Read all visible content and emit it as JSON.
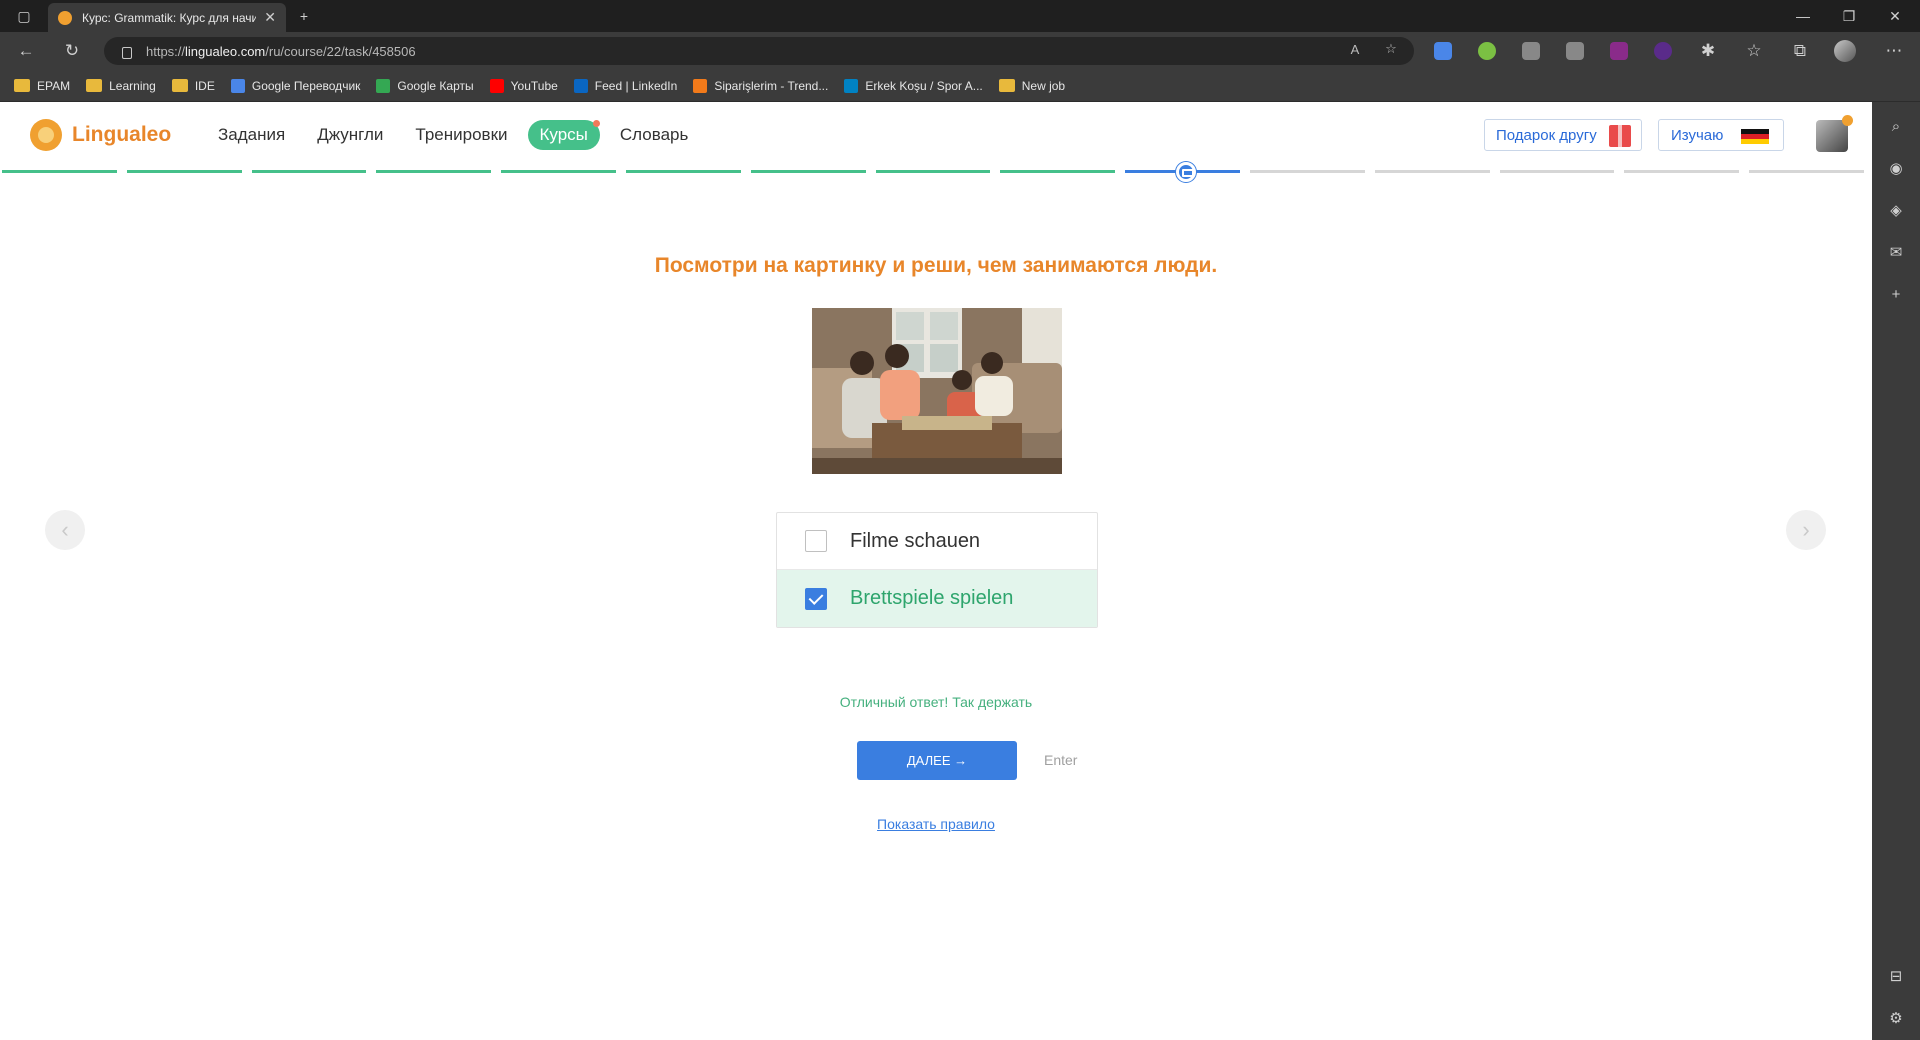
{
  "browser": {
    "tab_title": "Курс: Grammatik: Курс для начи",
    "url_prefix": "https://",
    "url_host": "lingualeo.com",
    "url_path": "/ru/course/22/task/458506",
    "bookmarks": [
      {
        "label": "EPAM",
        "icon": "folder-icon",
        "color": "#e8b93c"
      },
      {
        "label": "Learning",
        "icon": "folder-icon",
        "color": "#e8b93c"
      },
      {
        "label": "IDE",
        "icon": "folder-icon",
        "color": "#e8b93c"
      },
      {
        "label": "Google Переводчик",
        "icon": "google-translate-icon",
        "color": "#4a86e8"
      },
      {
        "label": "Google Карты",
        "icon": "google-maps-icon",
        "color": "#34a853"
      },
      {
        "label": "YouTube",
        "icon": "youtube-icon",
        "color": "#ff0000"
      },
      {
        "label": "Feed | LinkedIn",
        "icon": "linkedin-icon",
        "color": "#0a66c2"
      },
      {
        "label": "Siparişlerim - Trend...",
        "icon": "trendyol-icon",
        "color": "#f27a1a"
      },
      {
        "label": "Erkek Koşu / Spor A...",
        "icon": "decathlon-icon",
        "color": "#0082c3"
      },
      {
        "label": "New job",
        "icon": "folder-icon",
        "color": "#e8b93c"
      }
    ]
  },
  "header": {
    "logo_text": "Lingualeo",
    "menu": [
      {
        "label": "Задания",
        "active": false
      },
      {
        "label": "Джунгли",
        "active": false
      },
      {
        "label": "Тренировки",
        "active": false
      },
      {
        "label": "Курсы",
        "active": true
      },
      {
        "label": "Словарь",
        "active": false
      }
    ],
    "gift_button": "Подарок другу",
    "learning_button": "Изучаю",
    "learning_flag": "germany-flag-icon"
  },
  "progress": {
    "total_steps": 15,
    "completed_steps": 9,
    "current_step": 10
  },
  "task": {
    "question": "Посмотри на картинку и реши, чем занимаются люди.",
    "picture_icon": "family-boardgame-photo",
    "options": [
      {
        "label": "Filme schauen",
        "checked": false,
        "correct": false
      },
      {
        "label": "Brettspiele spielen",
        "checked": true,
        "correct": true
      }
    ],
    "feedback": "Отличный ответ! Так держать",
    "next_button": "ДАЛЕЕ →",
    "enter_hint": "Enter",
    "rule_link": "Показать правило"
  },
  "colors": {
    "accent_green": "#45c08a",
    "accent_blue": "#3a7ee0",
    "accent_orange": "#e8862a"
  }
}
